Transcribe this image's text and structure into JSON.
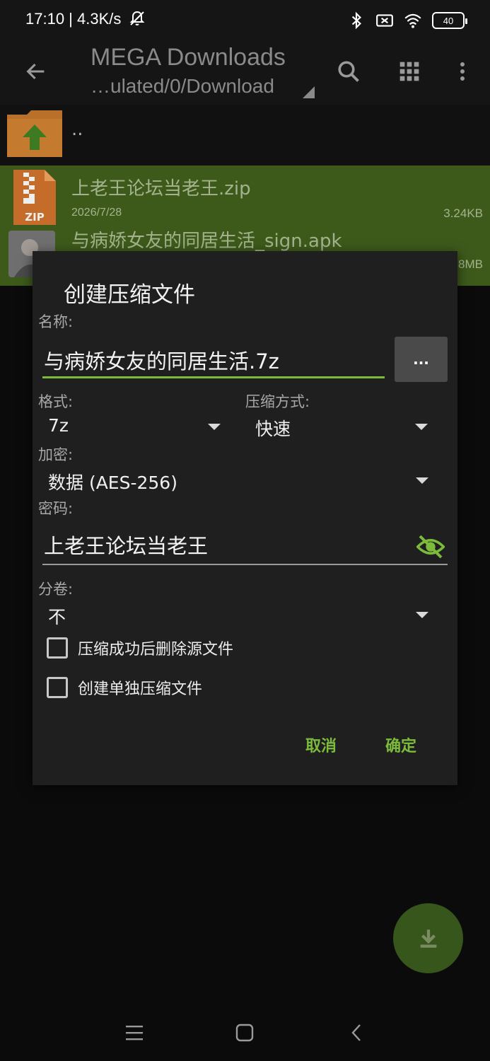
{
  "status_bar": {
    "time_speed": "17:10 | 4.3K/s",
    "battery_level": "40",
    "icons": [
      "bell-off-icon",
      "bluetooth-icon",
      "sim-off-icon",
      "wifi-icon",
      "battery-icon"
    ]
  },
  "toolbar": {
    "title": "MEGA Downloads",
    "path": "…ulated/0/Download",
    "icons": [
      "back-arrow-icon",
      "search-icon",
      "grid-view-icon",
      "more-vert-icon"
    ]
  },
  "file_list": {
    "parent_label": "..",
    "files": [
      {
        "name": "上老王论坛当老王.zip",
        "date": "2026/7/28",
        "size": "3.24KB",
        "icon": "zip-file-icon"
      },
      {
        "name": "与病娇女友的同居生活_sign.apk",
        "date": "",
        "size": "8MB",
        "icon": "apk-thumbnail-icon"
      }
    ]
  },
  "dialog": {
    "title": "创建压缩文件",
    "name_label": "名称:",
    "name_value": "与病娇女友的同居生活.7z",
    "browse_label": "...",
    "format_label": "格式:",
    "format_value": "7z",
    "method_label": "压缩方式:",
    "method_value": "快速",
    "encryption_label": "加密:",
    "encryption_value": "数据 (AES-256)",
    "password_label": "密码:",
    "password_value": "上老王论坛当老王",
    "volume_label": "分卷:",
    "volume_value": "不",
    "checkbox_delete": "压缩成功后删除源文件",
    "checkbox_separate": "创建单独压缩文件",
    "cancel_label": "取消",
    "ok_label": "确定"
  },
  "colors": {
    "accent": "#7cba3c",
    "selected_row": "#3d5a1b",
    "dialog_bg": "#1f1f1f",
    "fab": "#36561b"
  }
}
